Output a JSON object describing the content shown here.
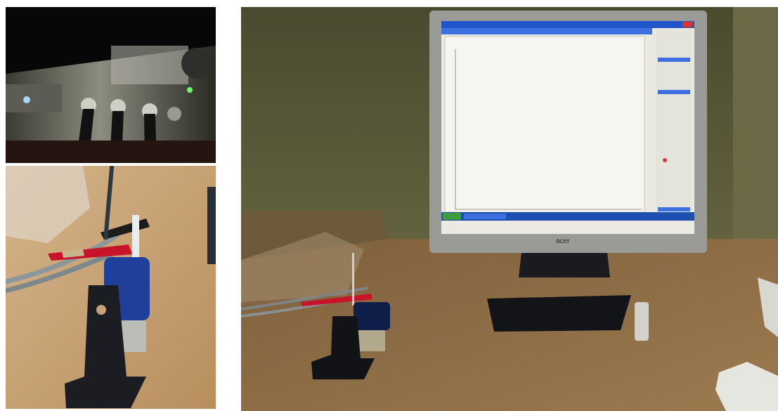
{
  "photos": [
    {
      "id": "potentiostat-closeup"
    },
    {
      "id": "electrochemical-cell-closeup"
    },
    {
      "id": "workstation-overview"
    }
  ],
  "monitor": {
    "brand": "acer"
  },
  "colors": {
    "wall": "#5a5a3c",
    "desk": "#8a6a45",
    "screen_bg": "#f1efe6",
    "window_bar": "#1f55c9",
    "taskbar": "#1c4fb0",
    "start_button": "#3f9c3a",
    "close_button": "#d9352b",
    "cell_cap": "#1f3f9a",
    "stand": "#1b1d22",
    "clip_red": "#c8142a"
  }
}
